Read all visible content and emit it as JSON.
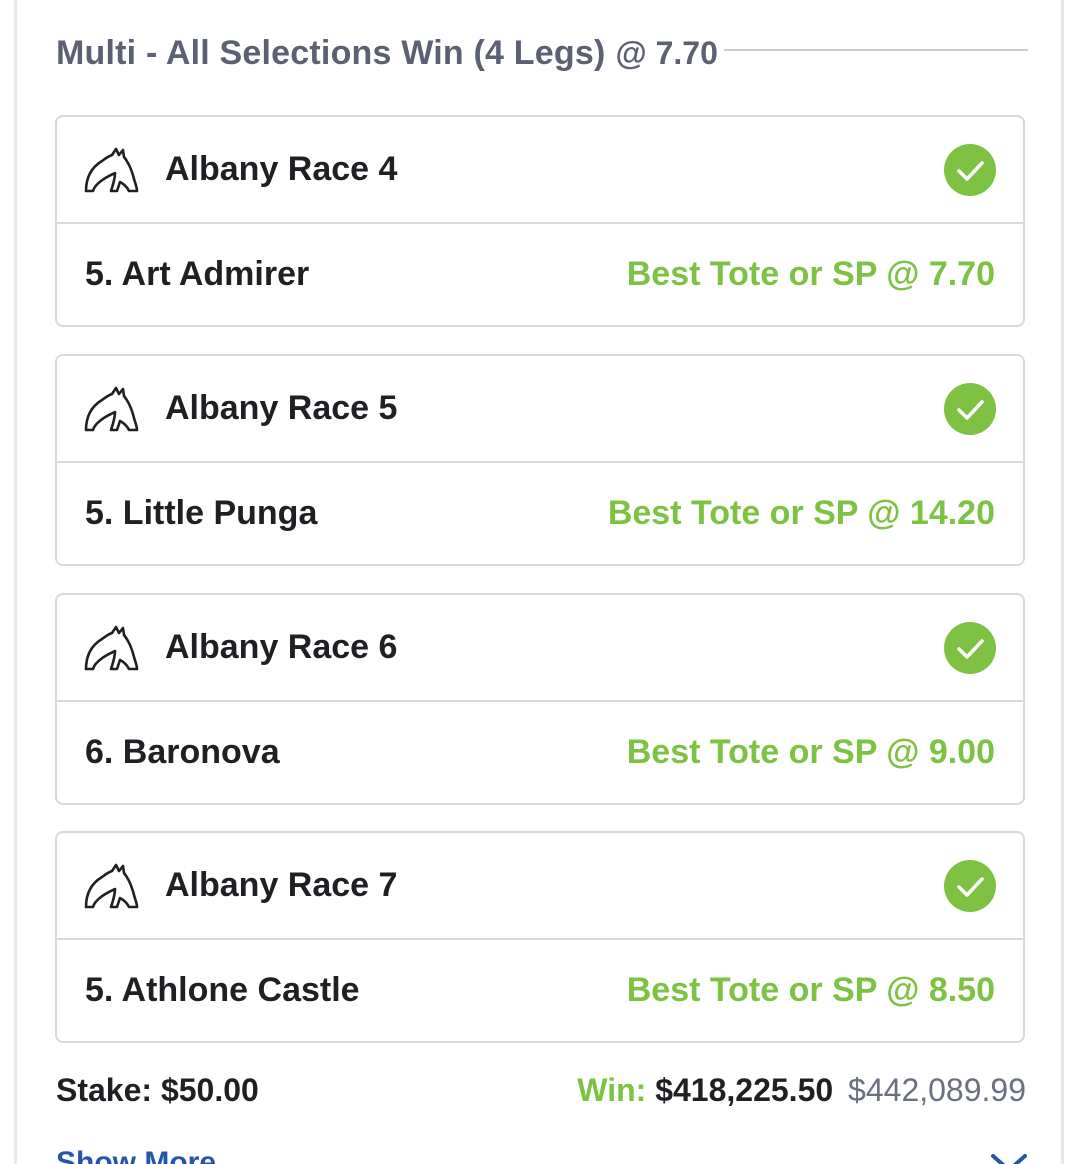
{
  "header": {
    "title": "Multi - All Selections Win (4 Legs)",
    "odds": "@ 7.70"
  },
  "legs": [
    {
      "race": "Albany Race 4",
      "runner": "5. Art Admirer",
      "price": "Best Tote or SP @ 7.70",
      "status": "won"
    },
    {
      "race": "Albany Race 5",
      "runner": "5. Little Punga",
      "price": "Best Tote or SP @ 14.20",
      "status": "won"
    },
    {
      "race": "Albany Race 6",
      "runner": "6. Baronova",
      "price": "Best Tote or SP @ 9.00",
      "status": "won"
    },
    {
      "race": "Albany Race 7",
      "runner": "5. Athlone Castle",
      "price": "Best Tote or SP @ 8.50",
      "status": "won"
    }
  ],
  "footer": {
    "stake_label": "Stake:",
    "stake_value": "$50.00",
    "win_label": "Win:",
    "win_value": "$418,225.50",
    "win_previous": "$442,089.99"
  },
  "show_more": "Show More",
  "icons": {
    "race_type": "horse-head-icon",
    "status": "check-circle-icon",
    "expand": "chevron-down-icon"
  },
  "colors": {
    "accent_green": "#7dc242",
    "link_blue": "#2556a8",
    "header_grey": "#5b6172"
  }
}
